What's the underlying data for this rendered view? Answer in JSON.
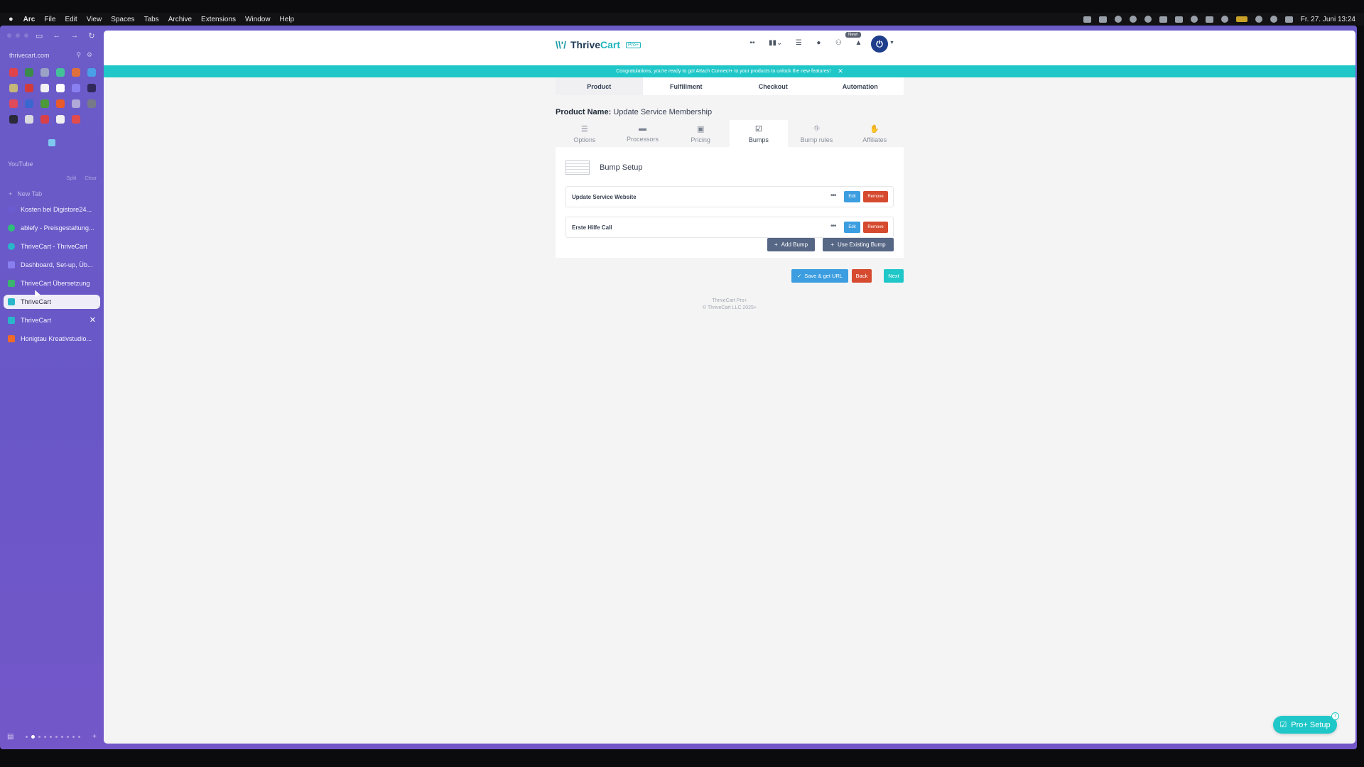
{
  "menubar": {
    "apple": "",
    "app": "Arc",
    "items": [
      "File",
      "Edit",
      "View",
      "Spaces",
      "Tabs",
      "Archive",
      "Extensions",
      "Window",
      "Help"
    ],
    "clock": "Fr. 27. Juni 13:24"
  },
  "sidebar": {
    "url": "thrivecart.com",
    "space_label": "YouTube",
    "tab_ops": [
      "Split",
      "Clear"
    ],
    "new_tab": "New Tab",
    "tabs": [
      {
        "label": "Kosten bei Digistore24...",
        "color": "#6a5bd0"
      },
      {
        "label": "ablefy - Preisgestaltung...",
        "color": "#2ebd7a"
      },
      {
        "label": "ThriveCart - ThriveCart",
        "color": "#29b6c9"
      },
      {
        "label": "Dashboard, Set-up, Üb...",
        "color": "#8a7ff0"
      },
      {
        "label": "ThriveCart Übersetzung",
        "color": "#3cb46e"
      },
      {
        "label": "ThriveCart",
        "color": "#29b6c9"
      },
      {
        "label": "ThriveCart",
        "color": "#29b6c9"
      },
      {
        "label": "Honigtau Kreativstudio...",
        "color": "#f06a2a"
      }
    ],
    "close_glyph": "✕"
  },
  "header": {
    "logo_thrive": "Thrive",
    "logo_cart": "Cart",
    "pro_badge": "Pro+",
    "new_pill": "New!",
    "power_glyph": "⏻"
  },
  "banner": {
    "text": "Congratulations, you're ready to go!  Attach Connect+ to your products to unlock the new features!",
    "close": "✕"
  },
  "main_nav": [
    "Product",
    "Fulfillment",
    "Checkout",
    "Automation"
  ],
  "product": {
    "name_label": "Product Name:",
    "name_value": "Update Service Membership"
  },
  "sub_tabs": [
    {
      "label": "Options",
      "icon": "☰"
    },
    {
      "label": "Processors",
      "icon": "▬"
    },
    {
      "label": "Pricing",
      "icon": "▣"
    },
    {
      "label": "Bumps",
      "icon": "☑"
    },
    {
      "label": "Bump rules",
      "icon": "⛗"
    },
    {
      "label": "Affiliates",
      "icon": "✋"
    }
  ],
  "bump_setup": {
    "title": "Bump Setup",
    "rows": [
      {
        "name": "Update Service Website",
        "edit": "Edit",
        "remove": "Remove"
      },
      {
        "name": "Erste Hilfe Call",
        "edit": "Edit",
        "remove": "Remove"
      }
    ],
    "more_glyph": "•••",
    "add_bump": "Add Bump",
    "use_existing": "Use Existing Bump"
  },
  "actions": {
    "save": "Save & get URL",
    "back": "Back",
    "next": "Next"
  },
  "footer": {
    "line1": "ThriveCart Pro+",
    "line2": "© ThriveCart LLC 2025+"
  },
  "pro_setup": {
    "label": "Pro+ Setup",
    "count": "7"
  }
}
